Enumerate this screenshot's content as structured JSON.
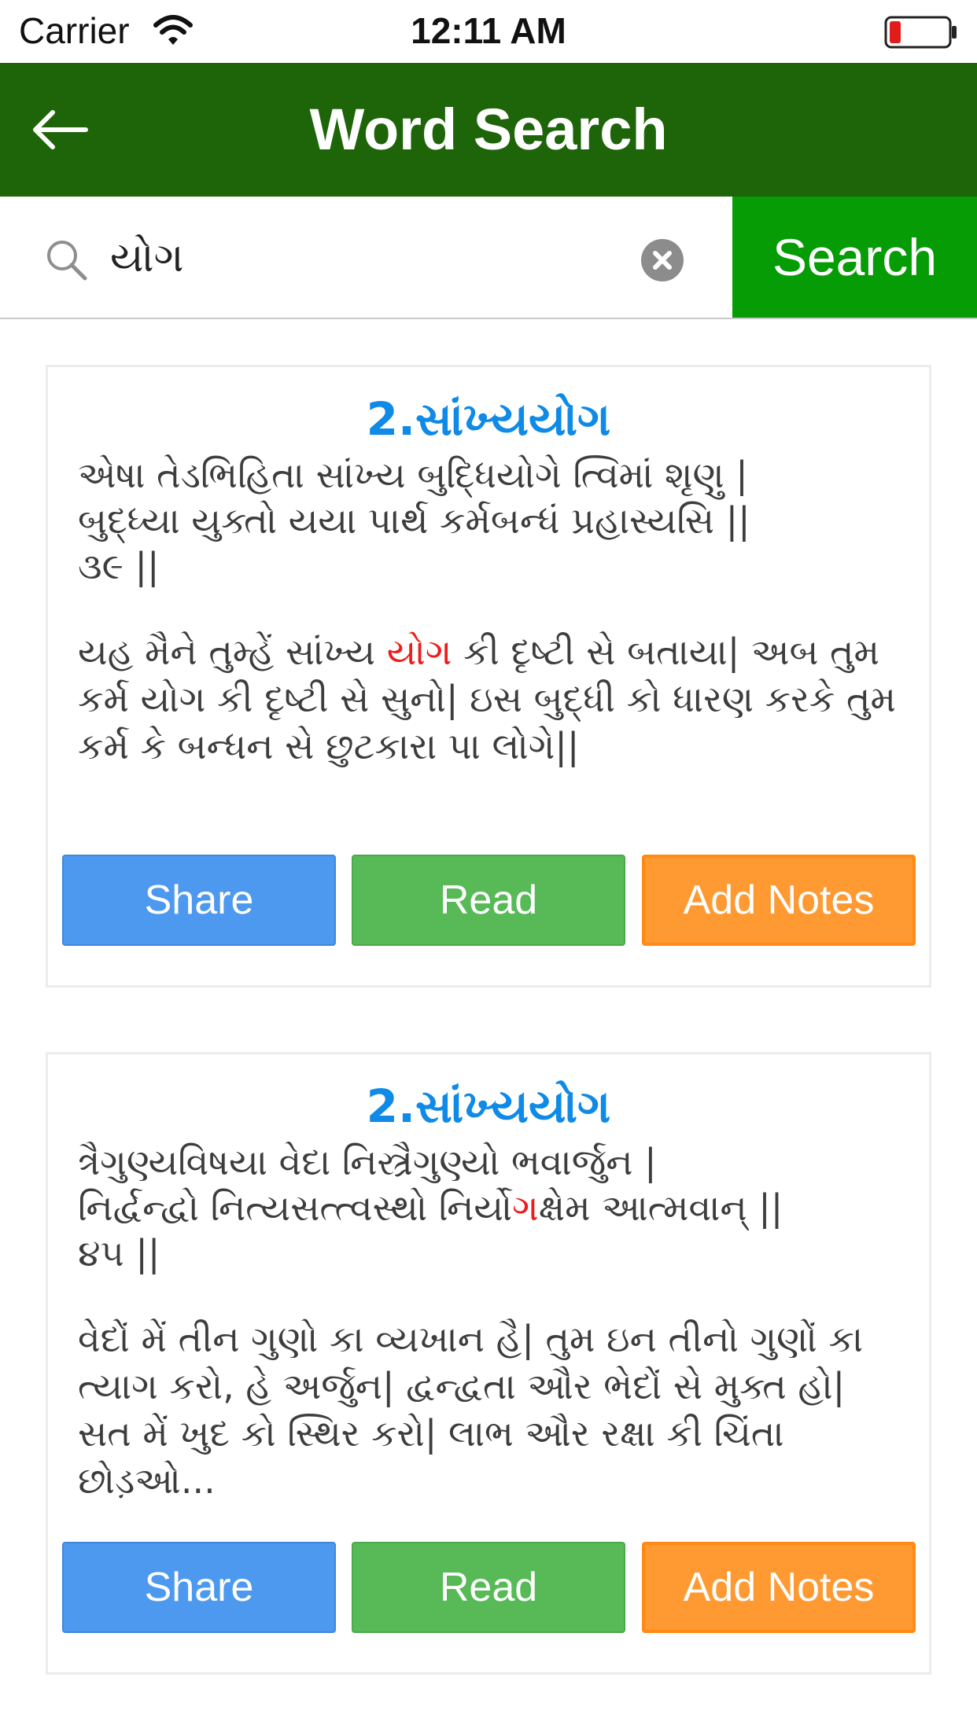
{
  "status_bar": {
    "carrier": "Carrier",
    "time": "12:11 AM"
  },
  "header": {
    "title": "Word Search",
    "back_icon": "arrow-left-icon"
  },
  "search": {
    "query": "યોગ",
    "button_label": "Search"
  },
  "results": [
    {
      "chapter": "2.સાંખ્યયોગ",
      "verse_lines": [
        "એષા તેડભિહિતા સાંખ્ય બુદ્ધિયોગે ત્વિમાં શૃણુ |",
        "બુદ્ધ્યા યુક્તો યયા પાર્થ કર્મબન્ધં પ્રહાસ્યસિ ||",
        "૩૯ ||"
      ],
      "translation": {
        "before": "યહ મૈને તુમ્હેં સાંખ્ય ",
        "match": "યોગ",
        "after": " કી દૃષ્ટી સે બતાયા| અબ તુમ કર્મ યોગ કી દૃષ્ટી સે સુનો| ઇસ બુદ્ધી કો ધારણ કરકે તુમ કર્મ કે બન્ધન સે છુટકારા પા લોગે||"
      },
      "buttons": {
        "share": "Share",
        "read": "Read",
        "notes": "Add Notes"
      }
    },
    {
      "chapter": "2.સાંખ્યયોગ",
      "verse_lines": [
        "ત્રૈગુણ્યવિષયા વેદા નિસ્ત્રૈગુણ્યો ભવાર્જુન |"
      ],
      "verse_line2": {
        "before": "નિર્દ્વન્દ્વો નિત્યસત્ત્વસ્થો નિર્યો",
        "match": "ગ",
        "after": "ક્ષેમ આત્મવાન્ ||"
      },
      "verse_line3": "૪૫ ||",
      "translation_text": "વેદોં મેં તીન ગુણો કા વ્યખાન હૈ| તુમ ઇન તીનો ગુણોં કા ત્યાગ કરો, હે અર્જુન| દ્વન્દ્વતા ઔર ભેદોં સે મુક્ત હો| સત મેં ખુદ કો સ્થિર કરો| લાભ ઔર રક્ષા કી ચિંતા છોડ઼ઓ...",
      "buttons": {
        "share": "Share",
        "read": "Read",
        "notes": "Add Notes"
      }
    }
  ],
  "colors": {
    "header": "#1e6408",
    "search_button": "#069c06",
    "chapter_title": "#0f8ae6",
    "highlight": "#ee1c1c",
    "share": "#4d99ef",
    "read": "#57ba57",
    "notes": "#ff9a33"
  }
}
